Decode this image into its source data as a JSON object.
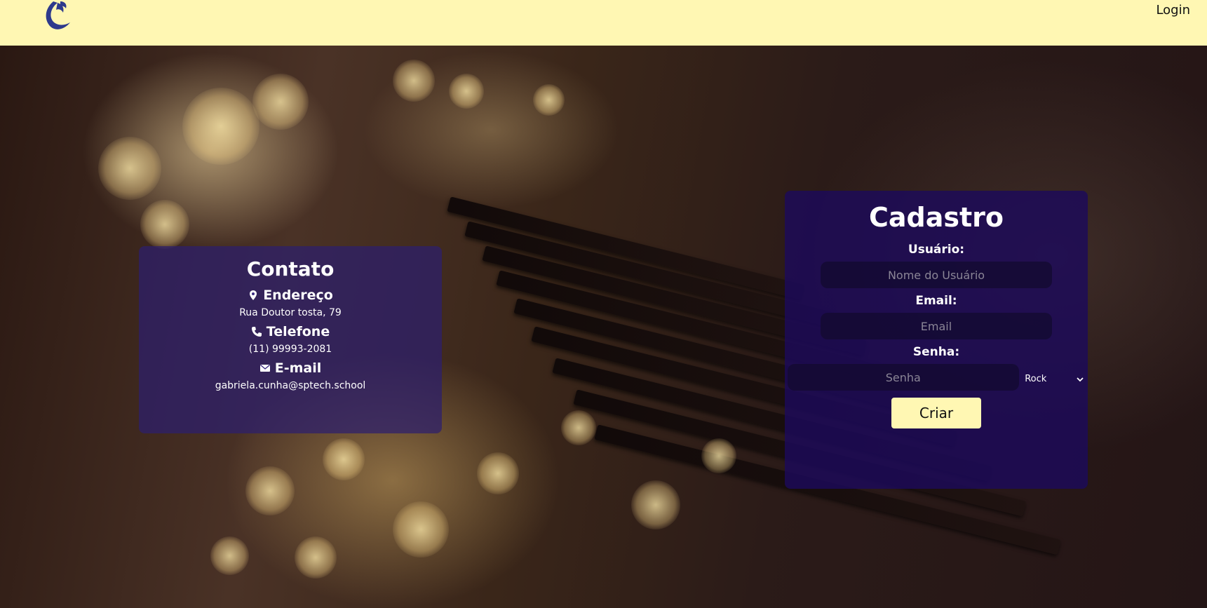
{
  "header": {
    "logo_icon": "feather-quill-logo",
    "login_label": "Login",
    "background_color": "#fff7b3"
  },
  "contact": {
    "title": "Contato",
    "address_label": "Endereço",
    "address_icon": "map-pin-icon",
    "address_value": "Rua Doutor tosta, 79",
    "phone_label": "Telefone",
    "phone_icon": "phone-icon",
    "phone_value": "(11) 99993-2081",
    "email_label": "E-mail",
    "email_icon": "envelope-icon",
    "email_value": "gabriela.cunha@sptech.school"
  },
  "signup": {
    "title": "Cadastro",
    "user_label": "Usuário:",
    "user_placeholder": "Nome do Usuário",
    "email_label": "Email:",
    "email_placeholder": "Email",
    "password_label": "Senha:",
    "password_placeholder": "Senha",
    "genre_selected": "Rock",
    "submit_label": "Criar"
  },
  "colors": {
    "accent": "#fff7b3",
    "card_purple": "#2d1e6e"
  }
}
